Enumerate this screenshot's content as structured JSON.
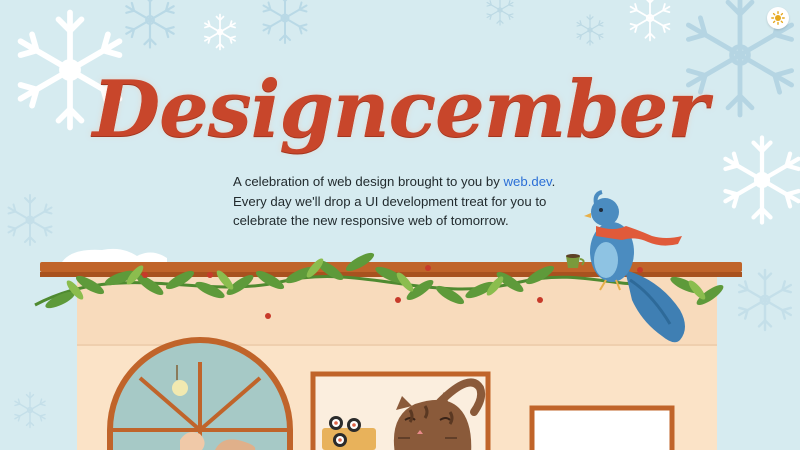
{
  "header": {
    "site_title": "Designcember",
    "theme_toggle_icon": "sun-icon"
  },
  "intro": {
    "text_before_link": "A celebration of web design brought to you by ",
    "link_text": "web.dev",
    "text_after_link": ". Every day we'll drop a UI development treat for you to celebrate the new responsive web of tomorrow."
  },
  "scene": {
    "icons": [
      "snowflake-icon",
      "bird-icon",
      "cat-icon",
      "sushi-icon",
      "coffee-cup-icon",
      "garland-icon"
    ],
    "colors": {
      "sky": "#d6ebf0",
      "title": "#c8462b",
      "wall": "#fbe3c7",
      "roof_trim": "#c0642a",
      "garland": "#5e9a3a",
      "link": "#2b6fd6"
    }
  }
}
